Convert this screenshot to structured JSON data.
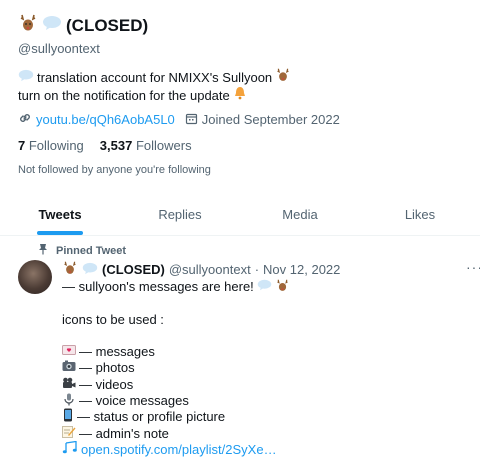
{
  "profile": {
    "name": "(CLOSED)",
    "handle": "@sullyoontext",
    "bio_line1": "translation account for NMIXX's Sullyoon",
    "bio_line2": "turn on the notification for the update",
    "link": "youtu.be/qQh6AobA5L0",
    "joined": "Joined September 2022",
    "following_count": "7",
    "following_label": "Following",
    "followers_count": "3,537",
    "followers_label": "Followers",
    "not_followed": "Not followed by anyone you're following"
  },
  "tabs": [
    {
      "label": "Tweets"
    },
    {
      "label": "Replies"
    },
    {
      "label": "Media"
    },
    {
      "label": "Likes"
    }
  ],
  "tweet": {
    "pinned_label": "Pinned Tweet",
    "name": "(CLOSED)",
    "handle": "@sullyoontext",
    "sep": "·",
    "date": "Nov 12, 2022",
    "line1": "— sullyoon's messages are here!",
    "icons_intro": "icons to be used :",
    "items": [
      {
        "text": "— messages"
      },
      {
        "text": "—  photos"
      },
      {
        "text": "— videos"
      },
      {
        "text": "—  voice messages"
      },
      {
        "text": "— status or profile picture"
      },
      {
        "text": "— admin's note"
      }
    ],
    "playlist_link": "open.spotify.com/playlist/2SyXe…"
  },
  "icons": {
    "deer": "deer-icon",
    "speech": "speech-bubble-icon",
    "bell": "bell-icon",
    "link": "link-icon",
    "calendar": "calendar-icon",
    "pin": "pin-icon",
    "more": "more-icon",
    "music": "music-notes-icon"
  },
  "colors": {
    "accent": "#1d9bf0",
    "text": "#0f1419",
    "secondary": "#536471"
  }
}
